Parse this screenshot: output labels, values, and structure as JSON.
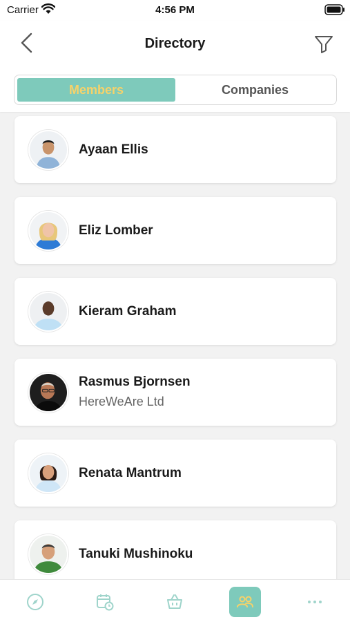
{
  "status_bar": {
    "carrier": "Carrier",
    "time": "4:56 PM"
  },
  "header": {
    "title": "Directory"
  },
  "segment": {
    "active_label": "Members",
    "inactive_label": "Companies"
  },
  "colors": {
    "accent": "#7ecabb",
    "accent_text": "#f6d26a",
    "tab_icon_inactive": "#9fd4cb"
  },
  "members": [
    {
      "name": "Ayaan Ellis",
      "company": ""
    },
    {
      "name": "Eliz Lomber",
      "company": ""
    },
    {
      "name": "Kieram Graham",
      "company": ""
    },
    {
      "name": "Rasmus Bjornsen",
      "company": "HereWeAre Ltd"
    },
    {
      "name": "Renata Mantrum",
      "company": ""
    },
    {
      "name": "Tanuki Mushinoku",
      "company": ""
    }
  ],
  "tabbar": {
    "items": [
      {
        "icon": "compass-icon"
      },
      {
        "icon": "calendar-clock-icon"
      },
      {
        "icon": "basket-icon"
      },
      {
        "icon": "people-icon",
        "active": true
      },
      {
        "icon": "more-icon"
      }
    ]
  }
}
